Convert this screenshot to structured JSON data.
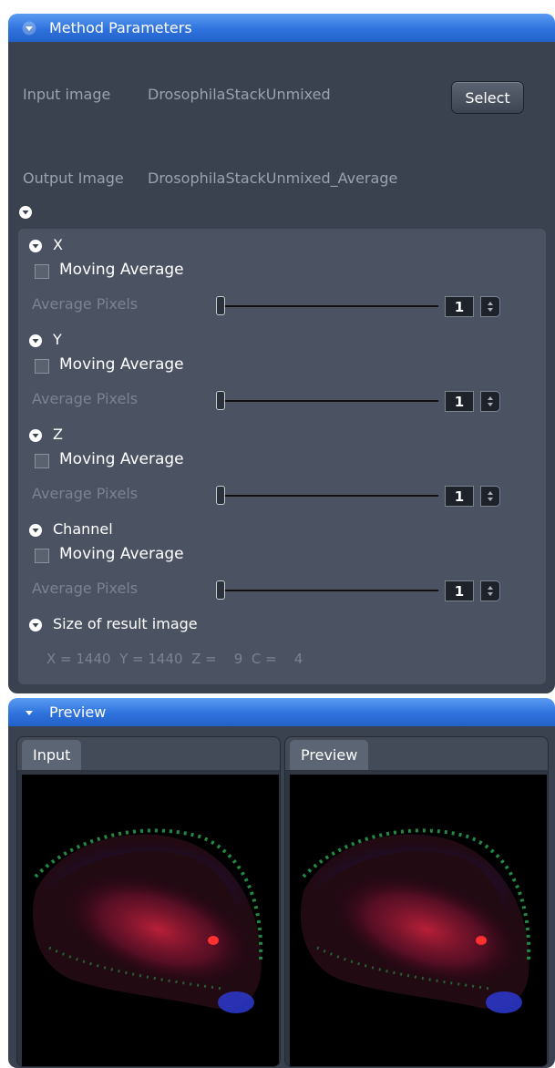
{
  "method_parameters": {
    "title": "Method Parameters",
    "input_label": "Input image",
    "input_value": "DrosophilaStackUnmixed",
    "select_label": "Select",
    "output_label": "Output Image",
    "output_value": "DrosophilaStackUnmixed_Average",
    "sections": [
      {
        "title": "X",
        "checkbox_label": "Moving Average",
        "checked": false,
        "avg_label": "Average Pixels",
        "value": "1"
      },
      {
        "title": "Y",
        "checkbox_label": "Moving Average",
        "checked": false,
        "avg_label": "Average Pixels",
        "value": "1"
      },
      {
        "title": "Z",
        "checkbox_label": "Moving Average",
        "checked": false,
        "avg_label": "Average Pixels",
        "value": "1"
      },
      {
        "title": "Channel",
        "checkbox_label": "Moving Average",
        "checked": false,
        "avg_label": "Average Pixels",
        "value": "1"
      }
    ],
    "result": {
      "title": "Size of result image",
      "text": "X = 1440  Y = 1440  Z =    9  C =    4"
    }
  },
  "preview": {
    "title": "Preview",
    "input_tab": "Input",
    "preview_tab": "Preview"
  },
  "colors": {
    "header_blue": "#2f72dd",
    "panel_bg": "#3a4250",
    "inner_bg": "#4b5362"
  }
}
